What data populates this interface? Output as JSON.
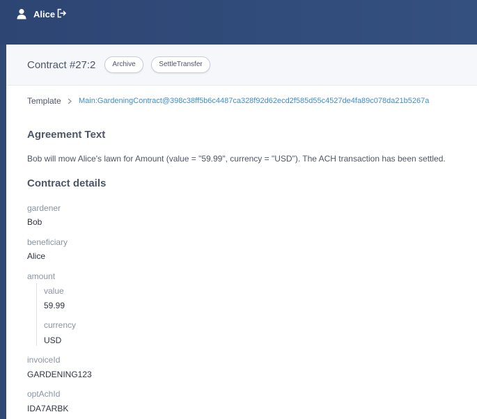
{
  "header": {
    "user_name": "Alice",
    "user_icon": "user-icon",
    "logout_icon": "logout-icon"
  },
  "contract": {
    "title": "Contract #27:2",
    "actions": [
      "Archive",
      "SettleTransfer"
    ]
  },
  "template": {
    "label": "Template",
    "chevron_icon": "chevron-right-icon",
    "id": "Main:GardeningContract@398c38ff5b6c4487ca328f92d62ecd2f585d55c4527de4fa89c078da21b5267a"
  },
  "agreement": {
    "heading": "Agreement Text",
    "text": "Bob will mow Alice's lawn for Amount (value = \"59.99\", currency = \"USD\"). The ACH transaction has been settled."
  },
  "details": {
    "heading": "Contract details",
    "gardener": {
      "label": "gardener",
      "value": "Bob"
    },
    "beneficiary": {
      "label": "beneficiary",
      "value": "Alice"
    },
    "amount": {
      "label": "amount",
      "value": {
        "label": "value",
        "value": "59.99"
      },
      "currency": {
        "label": "currency",
        "value": "USD"
      }
    },
    "invoiceId": {
      "label": "invoiceId",
      "value": "GARDENING123"
    },
    "optAchId": {
      "label": "optAchId",
      "value": "IDA7ARBK"
    }
  },
  "colors": {
    "header_bg": "#2f4874",
    "link": "#3f8dc9",
    "text": "#4d5566",
    "muted_label": "#8a93a3"
  }
}
